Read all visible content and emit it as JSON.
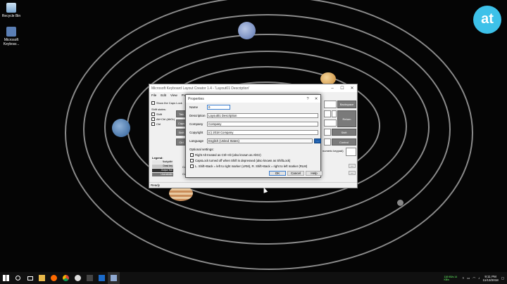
{
  "desktop": {
    "icons": [
      {
        "label": "Recycle Bin"
      },
      {
        "label": "Microsoft Keyboar..."
      }
    ],
    "logo_text": "at"
  },
  "app": {
    "title": "Microsoft Keyboard Layout Creator 1.4 - 'Layout01 Description'",
    "menu": [
      "File",
      "Edit",
      "View",
      "Project",
      "Help"
    ],
    "show_caps_label": "Show the Caps Lock",
    "shift_states_label": "Shift states:",
    "shift_states": [
      "Shift",
      "Alt+Ctrl (AltGr)",
      "Ctrl"
    ],
    "keys_left": [
      "Tab",
      "Caps",
      "Shift",
      "Ctrl"
    ],
    "keys_right": [
      "Backspace",
      "Return",
      "Shift",
      "Control"
    ],
    "numeric_keypad": "numeric keypad)",
    "legend_title": "Legend:",
    "legend_rows": [
      "Navigable",
      "Dead key",
      "Output Text",
      "Unavailable"
    ],
    "status": "Ready",
    "side_labels": [
      "Cu",
      "Cu"
    ]
  },
  "dialog": {
    "title": "Properties",
    "help_glyph": "?",
    "close_glyph": "✕",
    "fields": [
      {
        "label": "Name",
        "value": "0"
      },
      {
        "label": "Description",
        "value": "Layout01 Description"
      },
      {
        "label": "Company",
        "value": "Company"
      },
      {
        "label": "Copyright",
        "value": "(c) 2018 Company"
      },
      {
        "label": "Language",
        "value": "English (United States)"
      }
    ],
    "lang_button": "...",
    "optional_settings_label": "Optional settings:",
    "options": [
      "Right Alt treated as Ctrl+Alt (also known as AltGr)",
      "CapsLock turned off when Shift is depressed (also known as ShiftLock)",
      "L. Shift+Back = left to right marker (LRM), R. Shift+Back = right to left marker (RLM)"
    ],
    "buttons": {
      "ok": "OK",
      "cancel": "Cancel",
      "help": "Help"
    }
  },
  "taskbar": {
    "time": "9:11 PM",
    "date": "11/13/2018",
    "network": "118 KB/s 14 KB/s"
  }
}
